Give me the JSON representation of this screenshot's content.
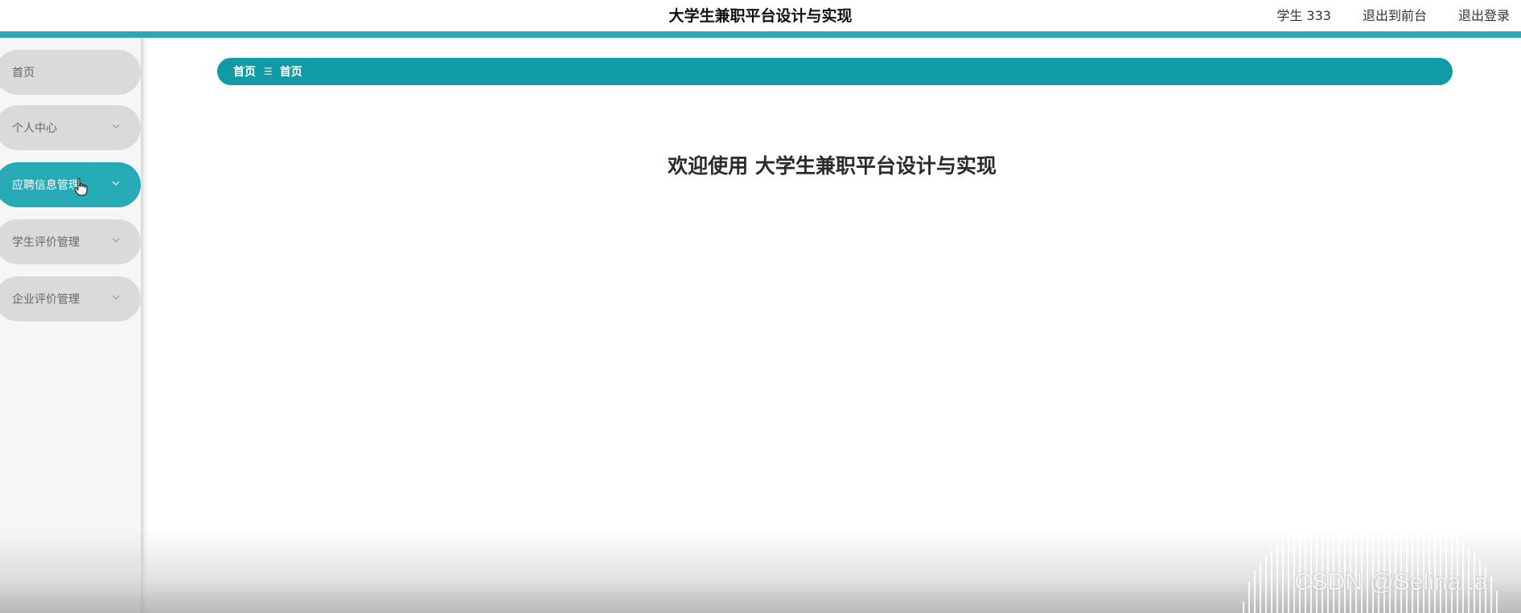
{
  "header": {
    "title": "大学生兼职平台设计与实现",
    "user_label": "学生 333",
    "to_frontend": "退出到前台",
    "logout": "退出登录",
    "accent_color": "#2aa9b3"
  },
  "sidebar": {
    "items": [
      {
        "label": "首页",
        "active": false,
        "has_chevron": false
      },
      {
        "label": "个人中心",
        "active": false,
        "has_chevron": true
      },
      {
        "label": "应聘信息管理",
        "active": true,
        "has_chevron": true
      },
      {
        "label": "学生评价管理",
        "active": false,
        "has_chevron": true
      },
      {
        "label": "企业评价管理",
        "active": false,
        "has_chevron": true
      }
    ],
    "active_color": "#25aab6"
  },
  "breadcrumb": {
    "items": [
      "首页",
      "首页"
    ],
    "separator_icon": "menu-lines-icon",
    "color": "#0f9aa6"
  },
  "main": {
    "welcome_prefix": "欢迎使用",
    "welcome_title": "大学生兼职平台设计与实现"
  },
  "watermark": "CSDN @Selina .a"
}
